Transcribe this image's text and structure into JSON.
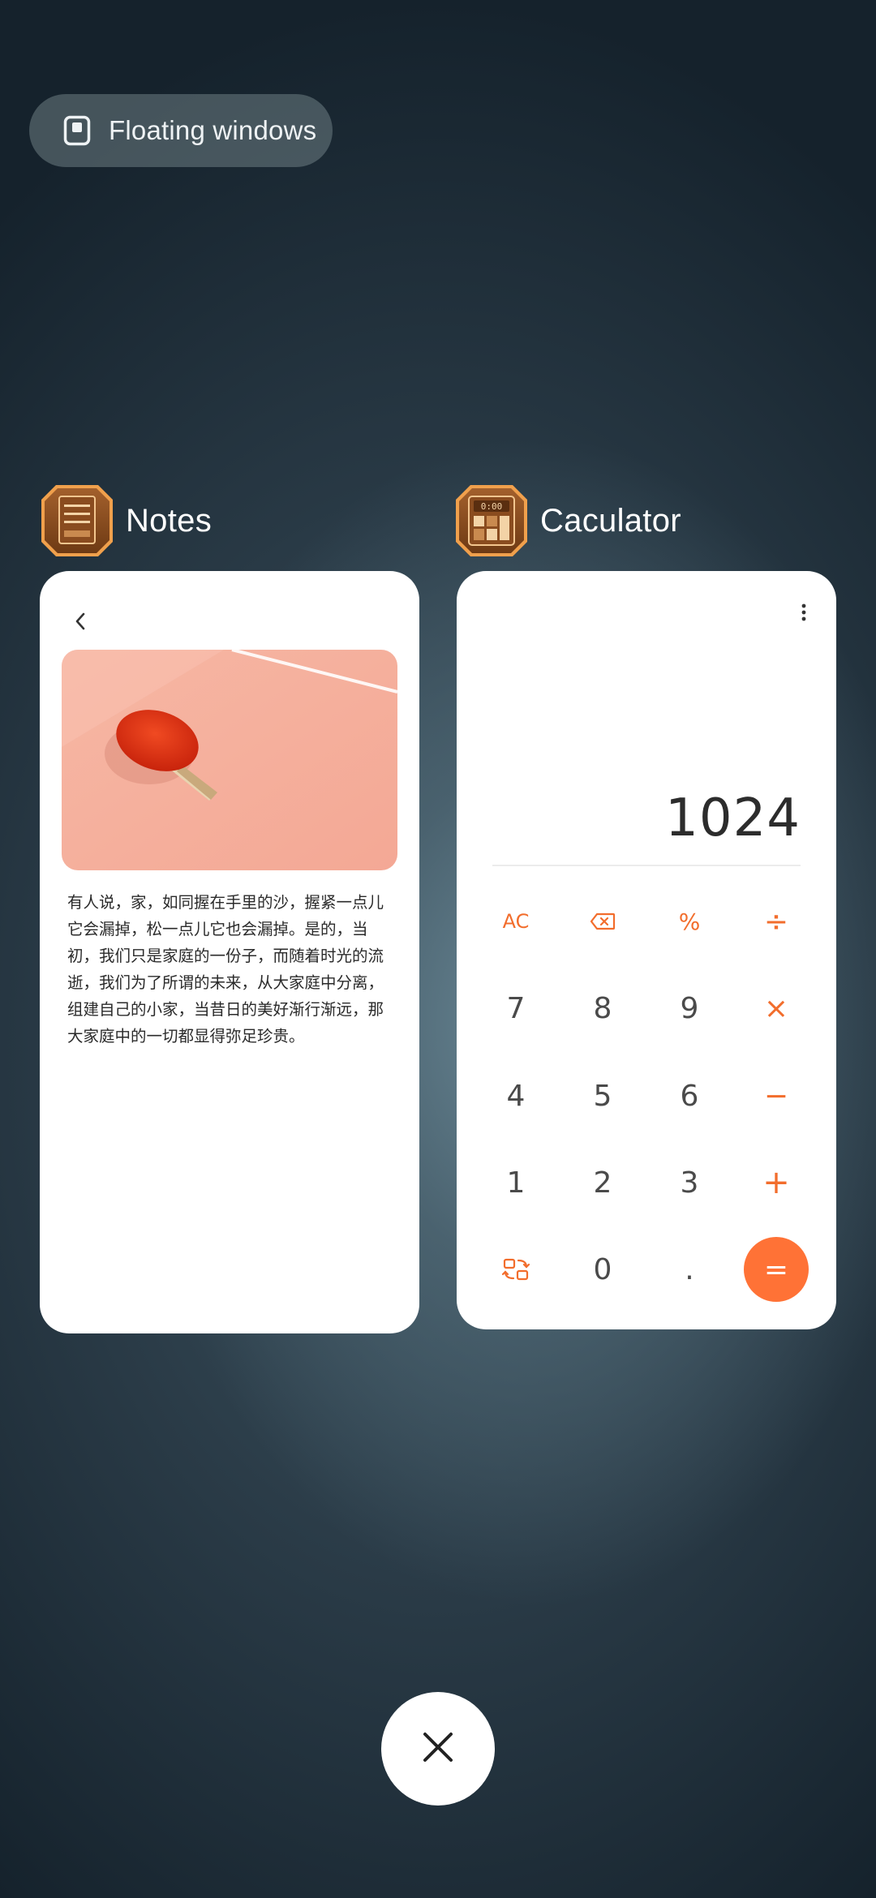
{
  "floating_windows": {
    "label": "Floating windows",
    "icon": "floating-window-icon"
  },
  "apps": [
    {
      "name": "Notes",
      "icon": "notes-app-icon",
      "content": {
        "back_icon": "chevron-left-icon",
        "image": "ping-pong-paddle-photo",
        "text": "有人说，家，如同握在手里的沙，握紧一点儿\n它会漏掉，松一点儿它也会漏掉。是的，当\n初，我们只是家庭的一份子，而随着时光的流\n逝，我们为了所谓的未来，从大家庭中分离，\n组建自己的小家，当昔日的美好渐行渐远，那\n大家庭中的一切都显得弥足珍贵。"
      }
    },
    {
      "name": "Caculator",
      "icon": "calculator-app-icon",
      "icon_text": "0:00",
      "content": {
        "menu_icon": "more-vertical-icon",
        "display": "1024",
        "keys": {
          "ac": "AC",
          "backspace": "backspace-icon",
          "percent": "%",
          "divide": "÷",
          "seven": "7",
          "eight": "8",
          "nine": "9",
          "multiply": "×",
          "four": "4",
          "five": "5",
          "six": "6",
          "minus": "−",
          "one": "1",
          "two": "2",
          "three": "3",
          "plus": "+",
          "switch": "switch-mode-icon",
          "zero": "0",
          "dot": ".",
          "equals": "="
        },
        "accent_color": "#ff7236"
      }
    }
  ],
  "close_button": {
    "icon": "close-icon"
  }
}
